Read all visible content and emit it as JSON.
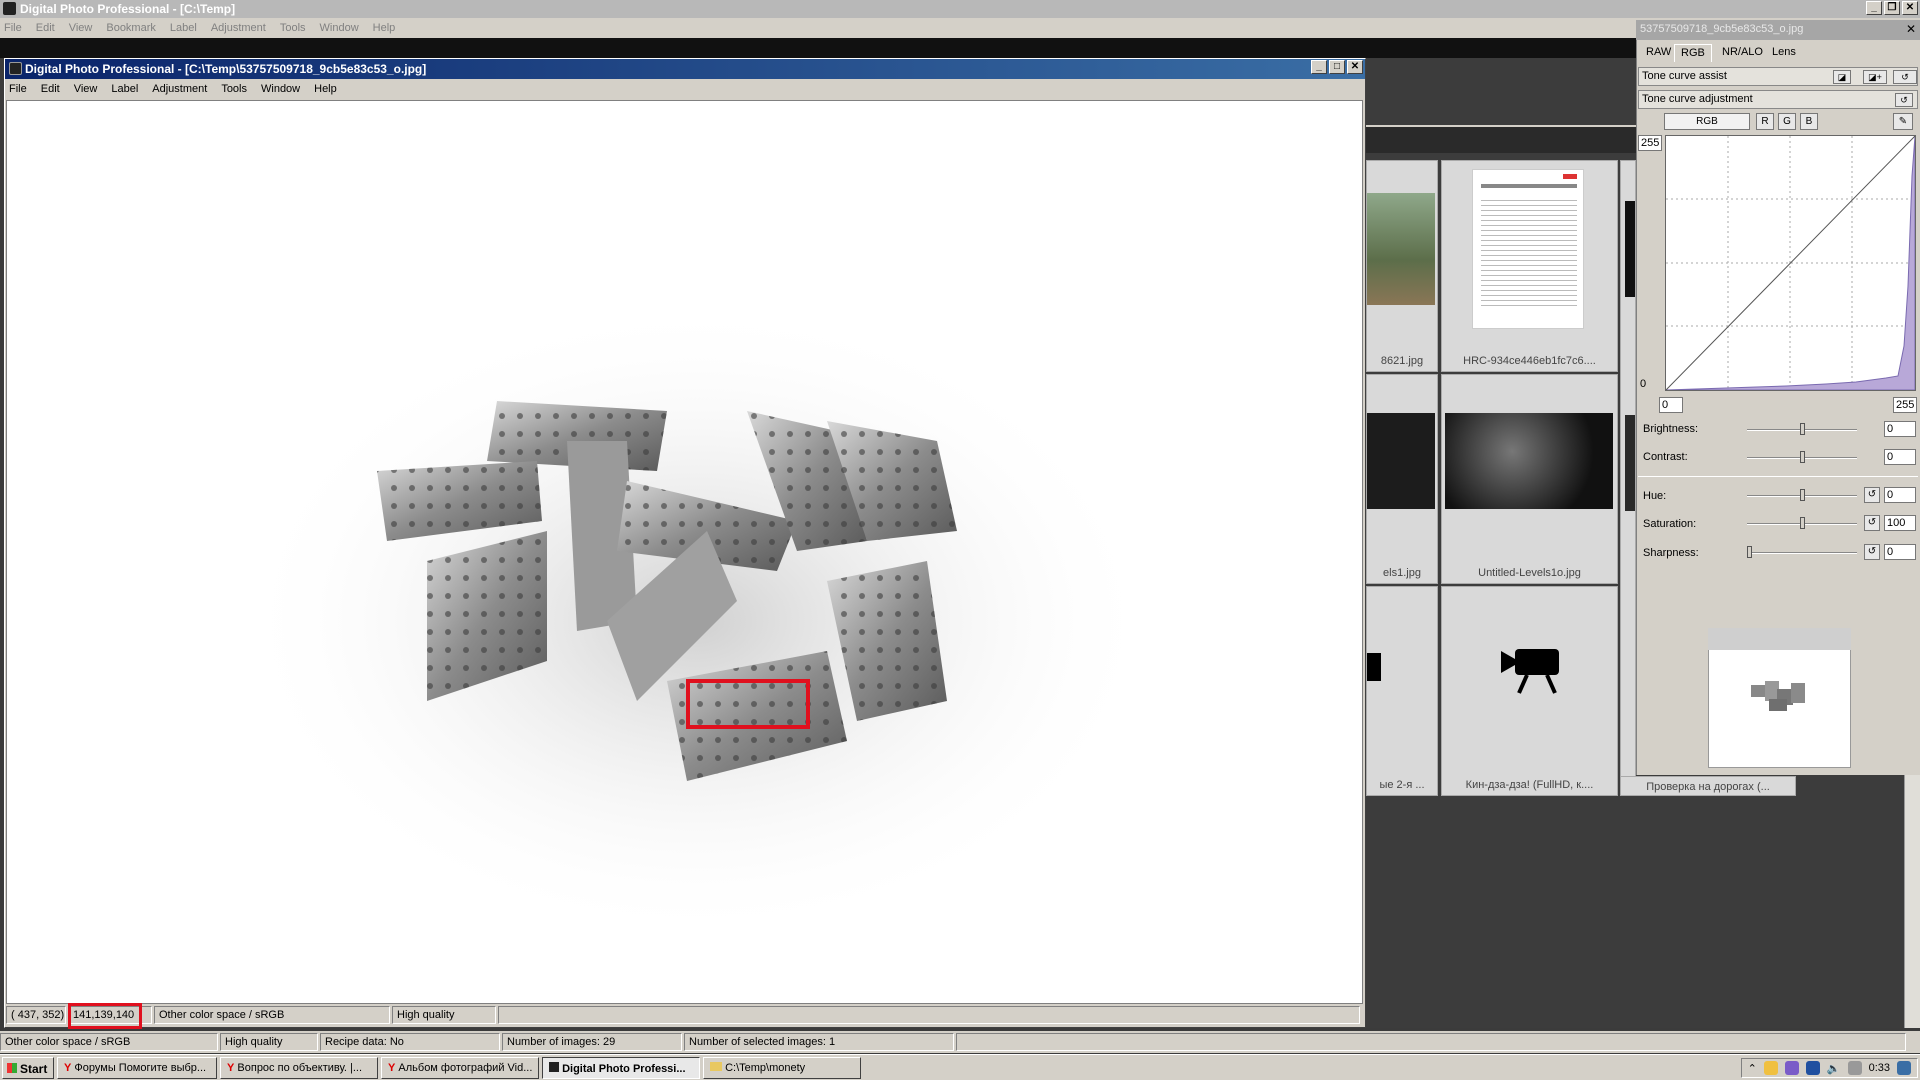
{
  "main_window": {
    "title": "Digital Photo Professional - [C:\\Temp]",
    "menu": [
      "File",
      "Edit",
      "View",
      "Bookmark",
      "Label",
      "Adjustment",
      "Tools",
      "Window",
      "Help"
    ]
  },
  "image_window": {
    "title": "Digital Photo Professional - [C:\\Temp\\53757509718_9cb5e83c53_o.jpg]",
    "menu": [
      "File",
      "Edit",
      "View",
      "Label",
      "Adjustment",
      "Tools",
      "Window",
      "Help"
    ],
    "status": {
      "coords": "( 437, 352)",
      "rgb": "141,139,140",
      "color_space": "Other color space / sRGB",
      "quality": "High quality"
    }
  },
  "thumbnails": [
    {
      "label": "8621.jpg"
    },
    {
      "label": "HRC-934ce446eb1fc7c6...."
    },
    {
      "label": "els1.jpg"
    },
    {
      "label": "Untitled-Levels1o.jpg"
    },
    {
      "label": "ые 2-я ..."
    },
    {
      "label": "Кин-дза-дза! (FullHD, к...."
    },
    {
      "label": "Проверка на дорогах (..."
    }
  ],
  "palette": {
    "title": "53757509718_9cb5e83c53_o.jpg",
    "tabs": [
      "RAW",
      "RGB",
      "NR/ALO",
      "Lens"
    ],
    "active_tab": "RGB",
    "tone_curve_assist": "Tone curve assist",
    "tone_curve_adjustment": "Tone curve adjustment",
    "channels": [
      "RGB",
      "R",
      "G",
      "B"
    ],
    "curve_max_label": "255",
    "curve_min_label": "0",
    "input_low": "0",
    "input_high": "255",
    "sliders": [
      {
        "label": "Brightness:",
        "value": "0",
        "level": 0.5
      },
      {
        "label": "Contrast:",
        "value": "0",
        "level": 0.5
      },
      {
        "label": "Hue:",
        "value": "0",
        "level": 0.5
      },
      {
        "label": "Saturation:",
        "value": "100",
        "level": 0.5
      },
      {
        "label": "Sharpness:",
        "value": "0",
        "level": 0.0
      }
    ]
  },
  "browser_status": {
    "color_space": "Other color space / sRGB",
    "quality": "High quality",
    "recipe": "Recipe data: No",
    "num_images": "Number of images: 29",
    "num_selected": "Number of selected images: 1"
  },
  "taskbar": {
    "start": "Start",
    "tasks": [
      {
        "label": "Форумы Помогите выбр...",
        "active": false
      },
      {
        "label": "Вопрос по объективу. |...",
        "active": false
      },
      {
        "label": "Альбом фотографий Vid...",
        "active": false
      },
      {
        "label": "Digital Photo Professi...",
        "active": true
      },
      {
        "label": "C:\\Temp\\monety",
        "active": false
      }
    ],
    "clock": "0:33"
  },
  "colors": {
    "highlight": "#e0101e",
    "title_active": "#0a246a",
    "title_inactive": "#b8b8b8"
  }
}
